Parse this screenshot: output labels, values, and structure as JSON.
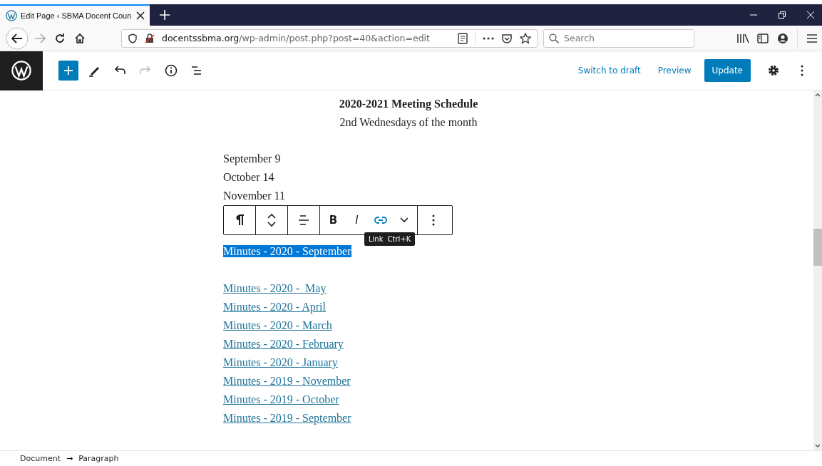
{
  "browser": {
    "tab": {
      "title": "Edit Page ‹ SBMA Docent Coun",
      "selected": true
    },
    "url": {
      "domain": "docentssbma.org",
      "path": "/wp-admin/post.php?post=40&action=edit"
    },
    "search": {
      "placeholder": "Search"
    }
  },
  "editor_header": {
    "actions": [
      {
        "label": "Switch to draft",
        "kind": "link"
      },
      {
        "label": "Preview",
        "kind": "link"
      },
      {
        "label": "Update",
        "kind": "primary"
      }
    ]
  },
  "content": {
    "heading": "2020-2021 Meeting Schedule",
    "subheading": "2nd Wednesdays of the month",
    "dates": [
      "September 9",
      "October 14",
      "November 11"
    ],
    "block_toolbar": {
      "format_buttons": [
        {
          "label": "B",
          "kind": "bold"
        },
        {
          "label": "I",
          "kind": "italic"
        }
      ],
      "tooltip": {
        "label": "Link",
        "shortcut": "Ctrl+K"
      }
    },
    "link_groups": [
      [
        {
          "text": "Minutes - 2020 - September",
          "selected": true
        }
      ],
      [
        {
          "text": "Minutes - 2020 -  May",
          "selected": false
        },
        {
          "text": "Minutes - 2020 - April",
          "selected": false
        },
        {
          "text": "Minutes - 2020 - March",
          "selected": false
        },
        {
          "text": "Minutes - 2020 - February",
          "selected": false
        },
        {
          "text": "Minutes - 2020 - January",
          "selected": false
        },
        {
          "text": "Minutes - 2019 - November",
          "selected": false
        },
        {
          "text": "Minutes - 2019 - October",
          "selected": false
        },
        {
          "text": "Minutes - 2019 - September",
          "selected": false
        }
      ]
    ]
  },
  "breadcrumb": {
    "items": [
      "Document",
      "Paragraph"
    ],
    "separator": "→"
  }
}
